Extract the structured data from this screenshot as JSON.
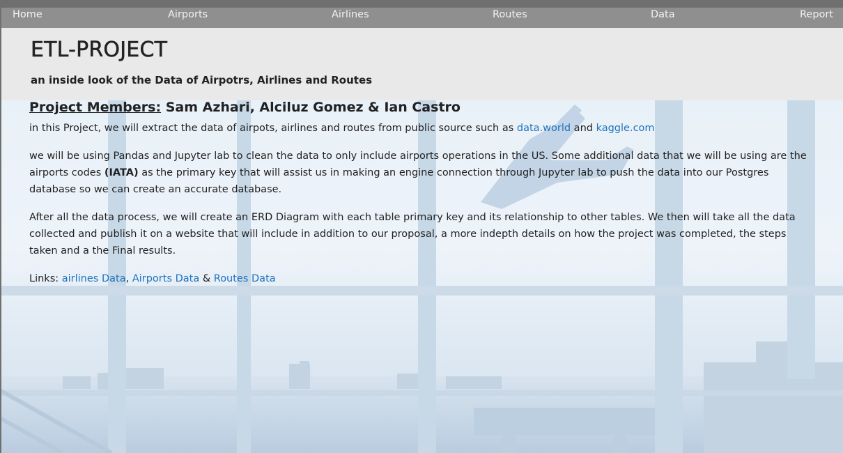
{
  "nav": {
    "items": [
      "Home",
      "Airports",
      "Airlines",
      "Routes",
      "Data",
      "Report"
    ]
  },
  "header": {
    "title": "ETL-PROJECT",
    "subtitle": "an inside look of the Data of Airpotrs, Airlines and Routes"
  },
  "content": {
    "members_label": "Project Members:",
    "members_names": " Sam Azhari, Alciluz Gomez & Ian Castro",
    "p1_text": "in this Project, we will extract the data of airpots, airlines and routes from public source such as ",
    "p1_link1": "data.world",
    "p1_and": " and ",
    "p1_link2": "kaggle.com",
    "p2_before": "we will be using Pandas and Jupyter lab to clean the data to only include airports operations in the US. Some additional data that we will be using are the airports codes ",
    "p2_bold": "(IATA)",
    "p2_after": " as the primary key that will assist us in making an engine connection through Jupyter lab to push the data into our Postgres database so we can create an accurate database.",
    "p3": "After all the data process, we will create an ERD Diagram with each table primary key and its relationship to other tables. We then will take all the data collected and publish it on a website that will include in addition to our proposal, a more indepth details on how the project was completed, the steps taken and a the Final results.",
    "links_label": "Links: ",
    "link_airlines": "airlines Data",
    "comma": ", ",
    "link_airports": "Airports Data",
    "amp": " & ",
    "link_routes": "Routes Data"
  },
  "colors": {
    "link": "#1e73c0",
    "navbar": "#8f8f8f",
    "jumbotron": "#e9e9e9"
  }
}
